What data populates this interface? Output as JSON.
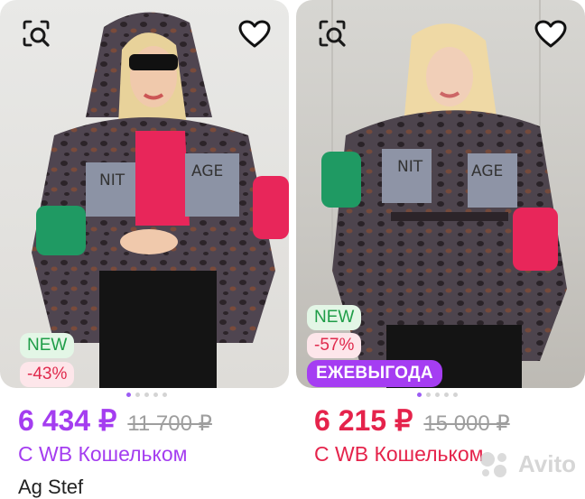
{
  "cards": [
    {
      "badges": {
        "new": "NEW",
        "discount": "-43%"
      },
      "price": "6 434 ₽",
      "old_price": "11 700 ₽",
      "wallet_label": "С WB Кошельком",
      "brand": "Ag Stef",
      "print_text": {
        "left": "NIT",
        "right": "AGE"
      },
      "image_dots": {
        "count": 5,
        "active": 1
      }
    },
    {
      "badges": {
        "new": "NEW",
        "discount": "-57%",
        "promo": "ЕЖЕВЫГОДА"
      },
      "price": "6 215 ₽",
      "old_price": "15 000 ₽",
      "wallet_label": "С WB Кошельком",
      "print_text": {
        "left": "NIT",
        "right": "AGE"
      },
      "image_dots": {
        "count": 5,
        "active": 1
      }
    }
  ],
  "watermark": {
    "text": "Avito"
  },
  "colors": {
    "purple": "#a43df0",
    "red": "#e5234b",
    "green_badge": "#1f9d48",
    "promo_bg": "#a53df2"
  }
}
